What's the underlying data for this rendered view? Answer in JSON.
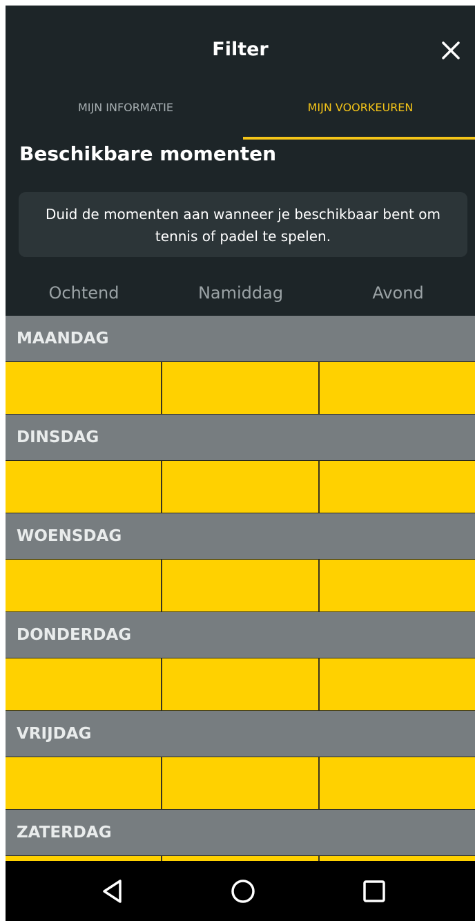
{
  "header": {
    "title": "Filter",
    "close_icon": "close-icon"
  },
  "tabs": [
    {
      "label": "MIJN INFORMATIE",
      "active": false
    },
    {
      "label": "MIJN VOORKEUREN",
      "active": true
    }
  ],
  "section": {
    "title": "Beschikbare momenten",
    "info_text": "Duid de momenten aan wanneer je beschikbaar bent om tennis of padel te spelen."
  },
  "columns": [
    "Ochtend",
    "Namiddag",
    "Avond"
  ],
  "days": [
    {
      "label": "MAANDAG"
    },
    {
      "label": "DINSDAG"
    },
    {
      "label": "WOENSDAG"
    },
    {
      "label": "DONDERDAG"
    },
    {
      "label": "VRIJDAG"
    },
    {
      "label": "ZATERDAG"
    }
  ],
  "colors": {
    "background": "#1d2528",
    "accent": "#f5c518",
    "slot_available": "#ffd100",
    "day_header": "#777d80"
  },
  "navbar": {
    "icons": [
      "back-icon",
      "home-icon",
      "recent-apps-icon"
    ]
  }
}
